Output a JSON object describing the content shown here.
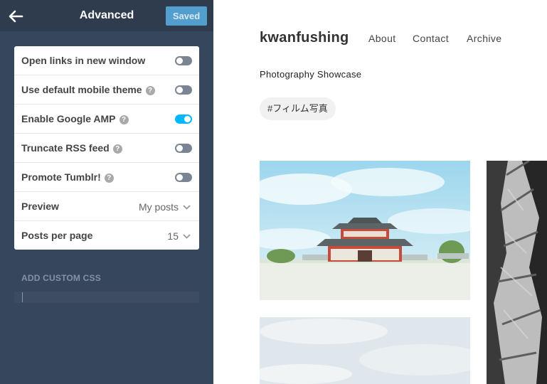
{
  "sidebar": {
    "title": "Advanced",
    "saved_label": "Saved",
    "settings": [
      {
        "label": "Open links in new window",
        "help": false,
        "toggle": false
      },
      {
        "label": "Use default mobile theme",
        "help": true,
        "toggle": false
      },
      {
        "label": "Enable Google AMP",
        "help": true,
        "toggle": true
      },
      {
        "label": "Truncate RSS feed",
        "help": true,
        "toggle": false
      },
      {
        "label": "Promote Tumblr!",
        "help": true,
        "toggle": false
      }
    ],
    "preview": {
      "label": "Preview",
      "value": "My posts"
    },
    "posts_per_page": {
      "label": "Posts per page",
      "value": "15"
    },
    "custom_css_label": "ADD CUSTOM CSS",
    "help_glyph": "?"
  },
  "blog": {
    "title": "kwanfushing",
    "nav": [
      "About",
      "Contact",
      "Archive"
    ],
    "description": "Photography Showcase",
    "tag": "#フィルム写真"
  },
  "colors": {
    "sidebar_bg": "#36465d",
    "topbar_bg": "#2f3c4e",
    "saved_button": "#529ecc",
    "toggle_on": "#00b8ff",
    "toggle_off": "#7b8492"
  },
  "icons": [
    "back-arrow-icon",
    "help-icon",
    "chevron-down-icon"
  ]
}
